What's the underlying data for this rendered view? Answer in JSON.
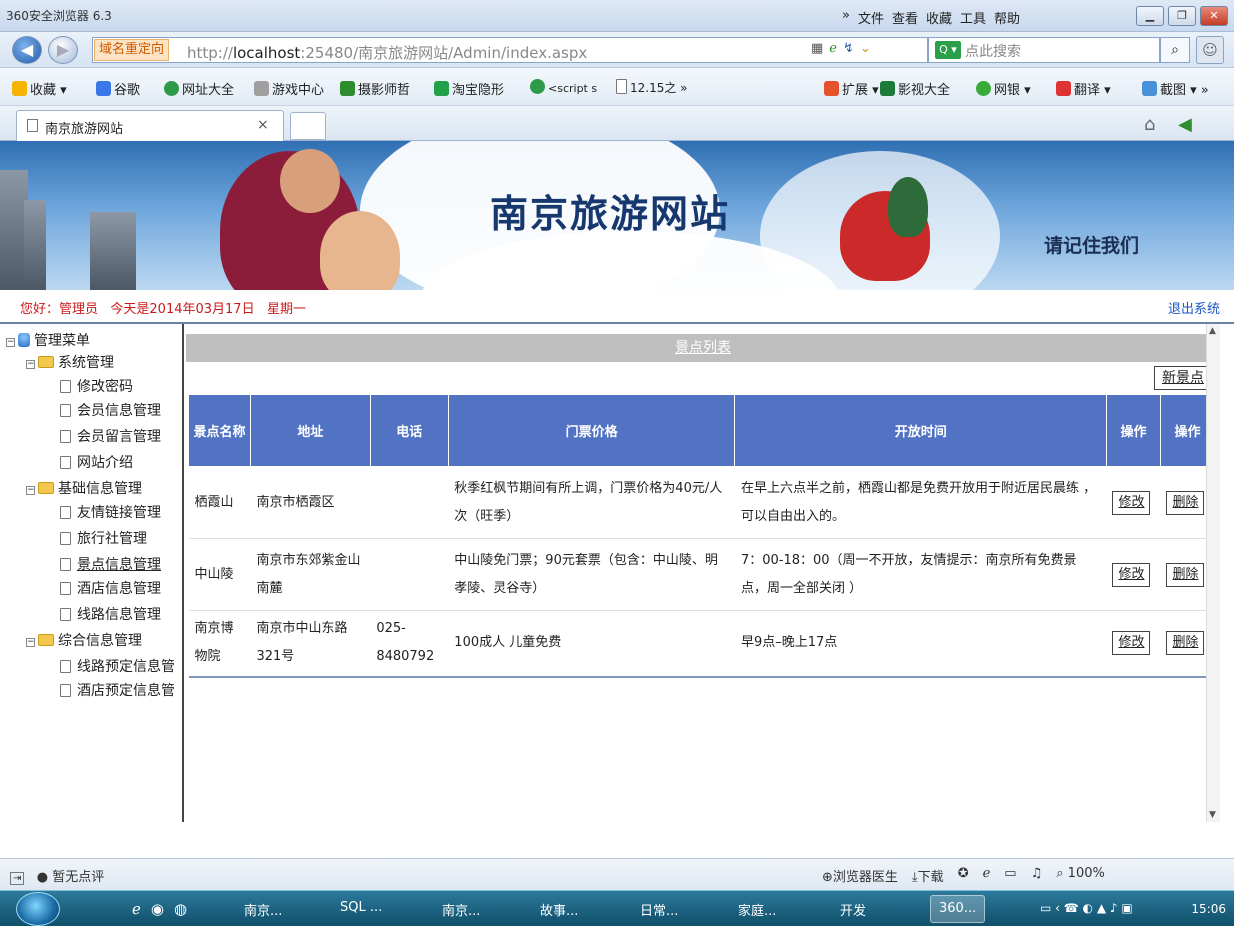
{
  "browser": {
    "app_title": "360安全浏览器 6.3",
    "menu": [
      "»",
      "文件",
      "查看",
      "收藏",
      "工具",
      "帮助"
    ],
    "redirect_tag": "域名重定向",
    "url_prefix": "http://",
    "url_host": "localhost",
    "url_rest": ":25480/南京旅游网站/Admin/index.aspx",
    "search_placeholder": "点此搜索",
    "bookmarks": [
      "收藏 ▾",
      "谷歌",
      "网址大全",
      "游戏中心",
      "摄影师哲",
      "淘宝隐形",
      "<script s",
      "12.15之 »"
    ],
    "right_tools": [
      "扩展 ▾",
      "影视大全",
      "网银 ▾",
      "翻译 ▾",
      "截图 ▾ »"
    ],
    "tab_title": "南京旅游网站",
    "tab_close": "×"
  },
  "banner": {
    "title": "南京旅游网站",
    "slogan": "请记住我们"
  },
  "welcome": {
    "greeting": "您好：管理员   今天是2014年03月17日   星期一",
    "logout": "退出系统"
  },
  "sidebar": {
    "root": "管理菜单",
    "groups": [
      {
        "label": "系统管理",
        "items": [
          "修改密码",
          "会员信息管理",
          "会员留言管理",
          "网站介绍"
        ]
      },
      {
        "label": "基础信息管理",
        "items": [
          "友情链接管理",
          "旅行社管理",
          "景点信息管理",
          "酒店信息管理",
          "线路信息管理"
        ]
      },
      {
        "label": "综合信息管理",
        "items": [
          "线路预定信息管",
          "酒店预定信息管"
        ]
      }
    ]
  },
  "main": {
    "header": "景点列表",
    "new_button": "新景点",
    "columns": [
      "景点名称",
      "地址",
      "电话",
      "门票价格",
      "开放时间",
      "操作",
      "操作"
    ],
    "rows": [
      {
        "name": "栖霞山",
        "address": "南京市栖霞区",
        "phone": "",
        "price": "秋季红枫节期间有所上调，门票价格为40元/人次（旺季）",
        "hours": "在早上六点半之前，栖霞山都是免费开放用于附近居民晨练 ，可以自由出入的。",
        "edit": "修改",
        "delete": "删除"
      },
      {
        "name": "中山陵",
        "address": "南京市东郊紫金山南麓",
        "phone": "",
        "price": "中山陵免门票；90元套票（包含：中山陵、明孝陵、灵谷寺）",
        "hours": "7：00-18：00（周一不开放，友情提示：南京所有免费景点，周一全部关闭 ）",
        "edit": "修改",
        "delete": "删除"
      },
      {
        "name": "南京博物院",
        "address": "南京市中山东路321号",
        "phone": "025-8480792",
        "price": "100成人 儿童免费",
        "hours": "早9点–晚上17点",
        "edit": "修改",
        "delete": "删除"
      }
    ]
  },
  "statusbar": {
    "left": "暂无点评",
    "right": [
      "浏览器医生",
      "下载",
      "100%"
    ]
  },
  "taskbar": {
    "tasks": [
      "南京...",
      "SQL ...",
      "南京...",
      "故事...",
      "日常...",
      "家庭...",
      "开发",
      "360..."
    ],
    "clock": "15:06"
  },
  "colors": {
    "table_header": "#5273c4",
    "greeting_red": "#cc1a1a",
    "link_blue": "#1a56c8"
  }
}
